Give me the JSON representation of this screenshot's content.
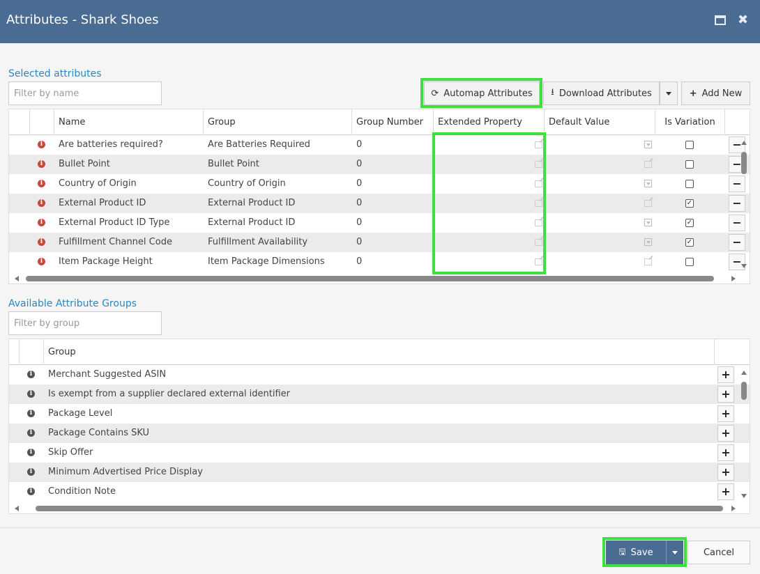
{
  "window": {
    "title": "Attributes - Shark Shoes",
    "maximize_icon": "maximize-icon",
    "close_icon": "close-icon"
  },
  "selected": {
    "section_label": "Selected attributes",
    "filter_placeholder": "Filter by name",
    "toolbar": {
      "automap_label": "Automap Attributes",
      "download_label": "Download Attributes",
      "add_new_label": "Add New"
    },
    "columns": [
      "Name",
      "Group",
      "Group Number",
      "Extended Property",
      "Default Value",
      "Is Variation"
    ],
    "rows": [
      {
        "name": "Are batteries required?",
        "group": "Are Batteries Required",
        "group_number": "0",
        "default_type": "dropdown",
        "is_variation": false
      },
      {
        "name": "Bullet Point",
        "group": "Bullet Point",
        "group_number": "0",
        "default_type": "text",
        "is_variation": false
      },
      {
        "name": "Country of Origin",
        "group": "Country of Origin",
        "group_number": "0",
        "default_type": "dropdown",
        "is_variation": false
      },
      {
        "name": "External Product ID",
        "group": "External Product ID",
        "group_number": "0",
        "default_type": "text",
        "is_variation": true
      },
      {
        "name": "External Product ID Type",
        "group": "External Product ID",
        "group_number": "0",
        "default_type": "dropdown",
        "is_variation": true
      },
      {
        "name": "Fulfillment Channel Code",
        "group": "Fulfillment Availability",
        "group_number": "0",
        "default_type": "dropdown",
        "is_variation": true
      },
      {
        "name": "Item Package Height",
        "group": "Item Package Dimensions",
        "group_number": "0",
        "default_type": "text",
        "is_variation": false
      }
    ]
  },
  "available": {
    "section_label": "Available Attribute Groups",
    "filter_placeholder": "Filter by group",
    "column": "Group",
    "rows": [
      "Merchant Suggested ASIN",
      "Is exempt from a supplier declared external identifier",
      "Package Level",
      "Package Contains SKU",
      "Skip Offer",
      "Minimum Advertised Price Display",
      "Condition Note"
    ]
  },
  "footer": {
    "save_label": "Save",
    "cancel_label": "Cancel"
  },
  "colors": {
    "titlebar": "#4a6b92",
    "highlight": "#3ee03e",
    "save_button": "#4a6b92",
    "link": "#2a87c0"
  }
}
